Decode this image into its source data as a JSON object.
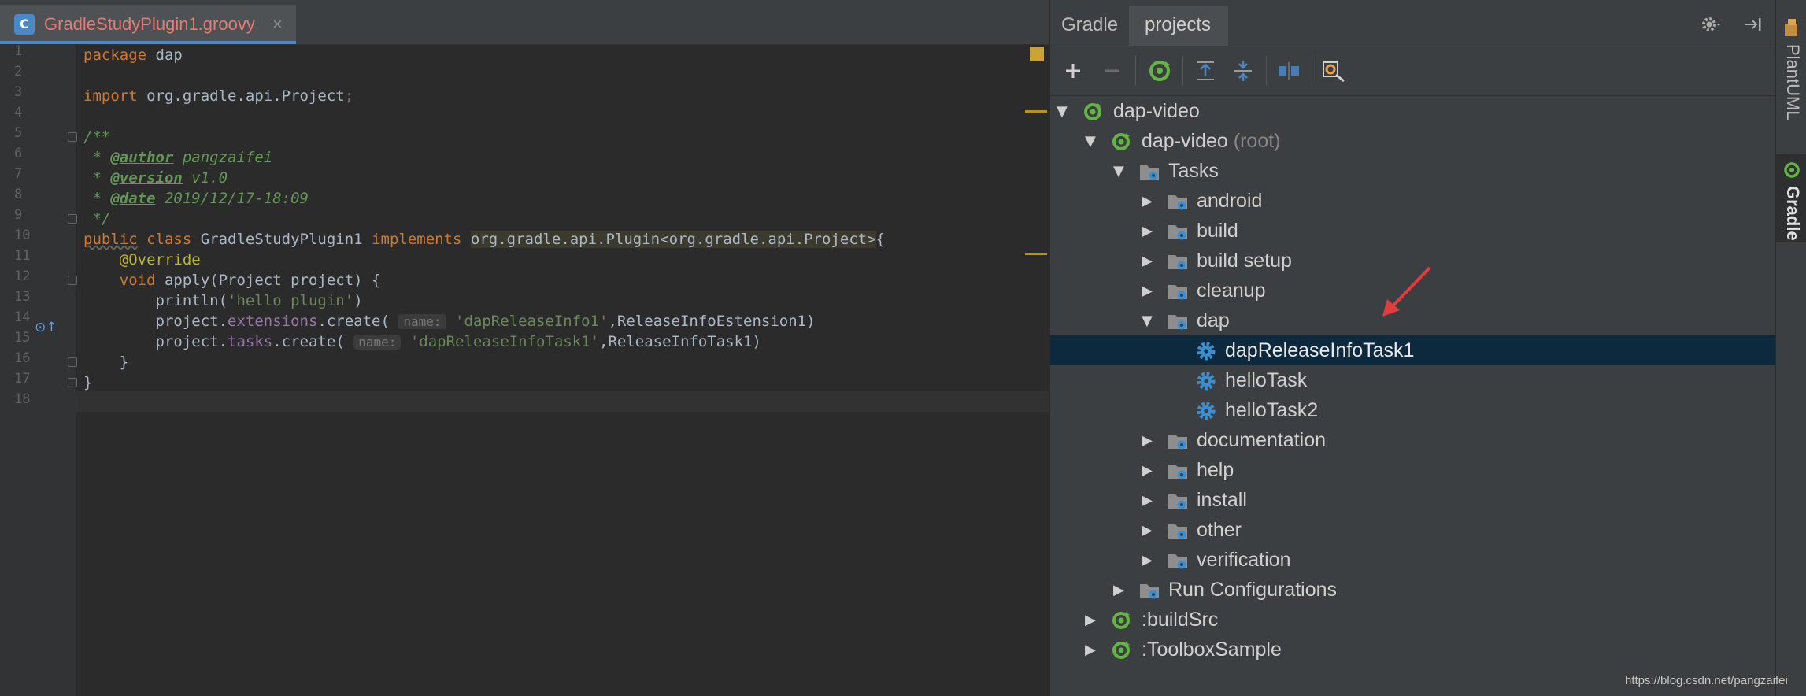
{
  "editor": {
    "tab_label": "GradleStudyPlugin1.groovy",
    "tab_icon_letter": "C",
    "tab_close": "×",
    "line_numbers": [
      "1",
      "2",
      "3",
      "4",
      "5",
      "6",
      "7",
      "8",
      "9",
      "10",
      "11",
      "12",
      "13",
      "14",
      "15",
      "16",
      "17",
      "18"
    ],
    "code": {
      "l1_kw": "package",
      "l1_rest": " dap",
      "l3_kw": "import",
      "l3_rest": " org.gradle.api.Project",
      "l3_semi": ";",
      "l5": "/**",
      "l6_pre": " * ",
      "l6_tag": "@author",
      "l6_val": " pangzaifei",
      "l7_pre": " * ",
      "l7_tag": "@version",
      "l7_val": " v1.0",
      "l8_pre": " * ",
      "l8_tag": "@date",
      "l8_val": " 2019/12/17-18:09",
      "l9": " */",
      "l10_public": "public",
      "l10_class": " class ",
      "l10_name": "GradleStudyPlugin1 ",
      "l10_impl": "implements",
      "l10_sp": " ",
      "l10_type": "org.gradle.api.Plugin<org.gradle.api.Project>",
      "l10_brace": "{",
      "l11_ann": "    @Override",
      "l12_kw": "    void",
      "l12_rest": " apply(Project project) {",
      "l13_pre": "        println(",
      "l13_str": "'hello plugin'",
      "l13_post": ")",
      "l14_pre": "        project.",
      "l14_fld": "extensions",
      "l14_mid": ".create( ",
      "l14_hint": "name:",
      "l14_sp": " ",
      "l14_str": "'dapReleaseInfo1'",
      "l14_post": ",ReleaseInfoEstension1)",
      "l15_pre": "        project.",
      "l15_fld": "tasks",
      "l15_mid": ".create( ",
      "l15_hint": "name:",
      "l15_sp": " ",
      "l15_str": "'dapReleaseInfoTask1'",
      "l15_post": ",ReleaseInfoTask1)",
      "l16": "    }",
      "l17": "}"
    }
  },
  "gradle_panel": {
    "title": "Gradle",
    "tab": "projects",
    "tree": [
      {
        "label": "dap-video",
        "muted": ""
      },
      {
        "label": "dap-video",
        "muted": " (root)"
      },
      {
        "label": "Tasks",
        "muted": ""
      },
      {
        "label": "android",
        "muted": ""
      },
      {
        "label": "build",
        "muted": ""
      },
      {
        "label": "build setup",
        "muted": ""
      },
      {
        "label": "cleanup",
        "muted": ""
      },
      {
        "label": "dap",
        "muted": ""
      },
      {
        "label": "dapReleaseInfoTask1",
        "muted": ""
      },
      {
        "label": "helloTask",
        "muted": ""
      },
      {
        "label": "helloTask2",
        "muted": ""
      },
      {
        "label": "documentation",
        "muted": ""
      },
      {
        "label": "help",
        "muted": ""
      },
      {
        "label": "install",
        "muted": ""
      },
      {
        "label": "other",
        "muted": ""
      },
      {
        "label": "verification",
        "muted": ""
      },
      {
        "label": "Run Configurations",
        "muted": ""
      },
      {
        "label": ":buildSrc",
        "muted": ""
      },
      {
        "label": ":ToolboxSample",
        "muted": ""
      }
    ]
  },
  "side_strip": {
    "plantuml_label": "PlantUML",
    "gradle_label": "Gradle"
  },
  "watermark": "https://blog.csdn.net/pangzaifei",
  "colors": {
    "editor_bg": "#2b2b2b",
    "panel_bg": "#3c3f41",
    "selection": "#0d293e",
    "tab_name": "#e37c74",
    "arrow_red": "#e03c3c"
  }
}
